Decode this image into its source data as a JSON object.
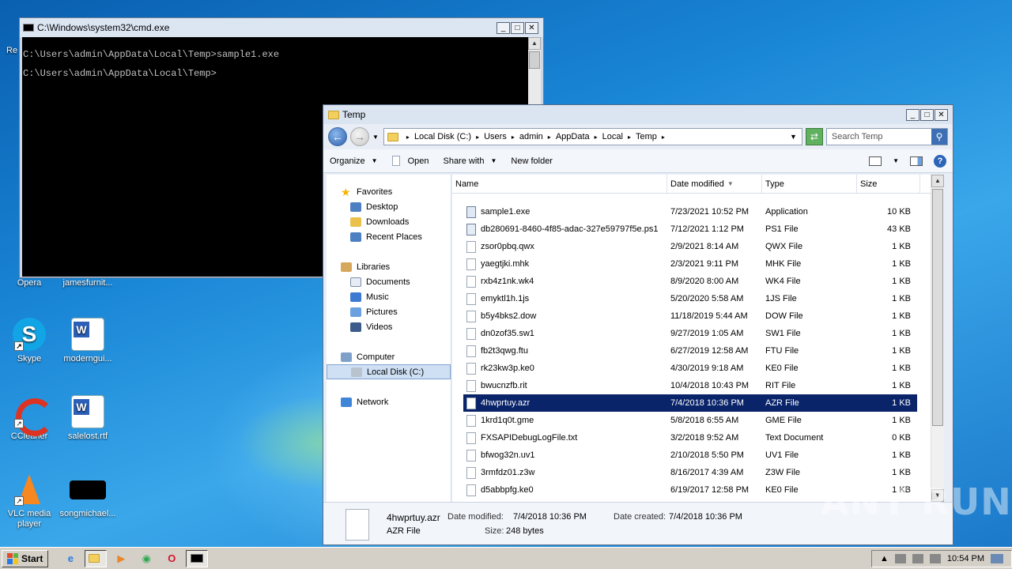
{
  "desktop": {
    "icons": [
      {
        "id": "re",
        "label": "Re"
      },
      {
        "id": "opera",
        "label": "Opera"
      },
      {
        "id": "jamesfurnit",
        "label": "jamesfurnit..."
      },
      {
        "id": "skype",
        "label": "Skype"
      },
      {
        "id": "modernguid",
        "label": "moderngui..."
      },
      {
        "id": "ccleaner",
        "label": "CCleaner"
      },
      {
        "id": "salelost",
        "label": "salelost.rtf"
      },
      {
        "id": "vlc",
        "label": "VLC media player"
      },
      {
        "id": "songmichael",
        "label": "songmichael..."
      }
    ],
    "watermark": "ANY RUN"
  },
  "cmd": {
    "title": "C:\\Windows\\system32\\cmd.exe",
    "lines": [
      "C:\\Users\\admin\\AppData\\Local\\Temp>sample1.exe",
      "C:\\Users\\admin\\AppData\\Local\\Temp>"
    ]
  },
  "explorer": {
    "title": "Temp",
    "breadcrumbs": [
      "Local Disk (C:)",
      "Users",
      "admin",
      "AppData",
      "Local",
      "Temp"
    ],
    "search_placeholder": "Search Temp",
    "toolbar": {
      "organize": "Organize",
      "open": "Open",
      "share_with": "Share with",
      "new_folder": "New folder"
    },
    "nav": {
      "favorites": "Favorites",
      "desktop": "Desktop",
      "downloads": "Downloads",
      "recent_places": "Recent Places",
      "libraries": "Libraries",
      "documents": "Documents",
      "music": "Music",
      "pictures": "Pictures",
      "videos": "Videos",
      "computer": "Computer",
      "local_disk": "Local Disk (C:)",
      "network": "Network"
    },
    "columns": {
      "name": "Name",
      "date": "Date modified",
      "type": "Type",
      "size": "Size"
    },
    "files": [
      {
        "name": "sample1.exe",
        "date": "7/23/2021 10:52 PM",
        "type": "Application",
        "size": "10 KB",
        "icon": "exe"
      },
      {
        "name": "db280691-8460-4f85-adac-327e59797f5e.ps1",
        "date": "7/12/2021 1:12 PM",
        "type": "PS1 File",
        "size": "43 KB",
        "icon": "ps1"
      },
      {
        "name": "zsor0pbq.qwx",
        "date": "2/9/2021 8:14 AM",
        "type": "QWX File",
        "size": "1 KB",
        "icon": "file"
      },
      {
        "name": "yaegtjki.mhk",
        "date": "2/3/2021 9:11 PM",
        "type": "MHK File",
        "size": "1 KB",
        "icon": "file"
      },
      {
        "name": "rxb4z1nk.wk4",
        "date": "8/9/2020 8:00 AM",
        "type": "WK4 File",
        "size": "1 KB",
        "icon": "file"
      },
      {
        "name": "emyktl1h.1js",
        "date": "5/20/2020 5:58 AM",
        "type": "1JS File",
        "size": "1 KB",
        "icon": "file"
      },
      {
        "name": "b5y4bks2.dow",
        "date": "11/18/2019 5:44 AM",
        "type": "DOW File",
        "size": "1 KB",
        "icon": "file"
      },
      {
        "name": "dn0zof35.sw1",
        "date": "9/27/2019 1:05 AM",
        "type": "SW1 File",
        "size": "1 KB",
        "icon": "file"
      },
      {
        "name": "fb2t3qwg.ftu",
        "date": "6/27/2019 12:58 AM",
        "type": "FTU File",
        "size": "1 KB",
        "icon": "file"
      },
      {
        "name": "rk23kw3p.ke0",
        "date": "4/30/2019 9:18 AM",
        "type": "KE0 File",
        "size": "1 KB",
        "icon": "file"
      },
      {
        "name": "bwucnzfb.rit",
        "date": "10/4/2018 10:43 PM",
        "type": "RIT File",
        "size": "1 KB",
        "icon": "file"
      },
      {
        "name": "4hwprtuy.azr",
        "date": "7/4/2018 10:36 PM",
        "type": "AZR File",
        "size": "1 KB",
        "icon": "file",
        "selected": true
      },
      {
        "name": "1krd1q0t.gme",
        "date": "5/8/2018 6:55 AM",
        "type": "GME File",
        "size": "1 KB",
        "icon": "file"
      },
      {
        "name": "FXSAPIDebugLogFile.txt",
        "date": "3/2/2018 9:52 AM",
        "type": "Text Document",
        "size": "0 KB",
        "icon": "file"
      },
      {
        "name": "bfwog32n.uv1",
        "date": "2/10/2018 5:50 PM",
        "type": "UV1 File",
        "size": "1 KB",
        "icon": "file"
      },
      {
        "name": "3rmfdz01.z3w",
        "date": "8/16/2017 4:39 AM",
        "type": "Z3W File",
        "size": "1 KB",
        "icon": "file"
      },
      {
        "name": "d5abbpfg.ke0",
        "date": "6/19/2017 12:58 PM",
        "type": "KE0 File",
        "size": "1 KB",
        "icon": "file"
      }
    ],
    "details": {
      "name": "4hwprtuy.azr",
      "type": "AZR File",
      "date_modified_label": "Date modified:",
      "date_modified": "7/4/2018 10:36 PM",
      "date_created_label": "Date created:",
      "date_created": "7/4/2018 10:36 PM",
      "size_label": "Size:",
      "size": "248 bytes"
    }
  },
  "taskbar": {
    "start": "Start",
    "clock": "10:54 PM"
  }
}
